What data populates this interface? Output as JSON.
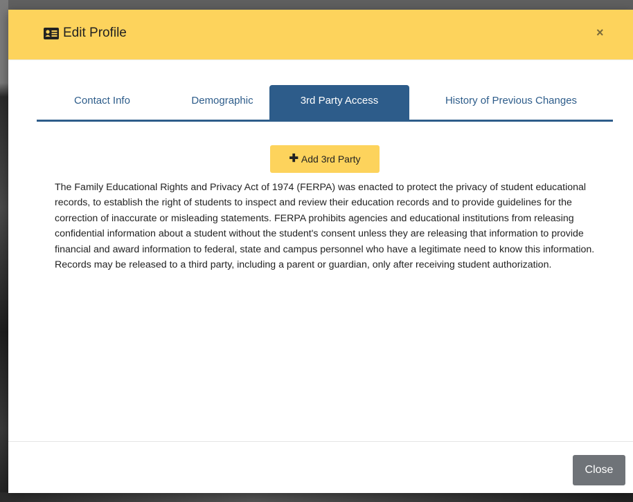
{
  "modal": {
    "title": "Edit Profile",
    "title_icon": "id-card-icon",
    "close_glyph": "×",
    "accent_color": "#fdd35c",
    "tab_color": "#2d5c8a"
  },
  "tabs": [
    {
      "label": "Contact Info",
      "active": false
    },
    {
      "label": "Demographic",
      "active": false
    },
    {
      "label": "3rd Party Access",
      "active": true
    },
    {
      "label": "History of Previous Changes",
      "active": false
    }
  ],
  "content": {
    "add_button_label": "Add 3rd Party",
    "add_button_icon": "plus-icon",
    "ferpa_text": "The Family Educational Rights and Privacy Act of 1974 (FERPA) was enacted to protect the privacy of student educational records, to establish the right of students to inspect and review their education records and to provide guidelines for the correction of inaccurate or misleading statements. FERPA prohibits agencies and educational institutions from releasing confidential information about a student without the student's consent unless they are releasing that information to provide financial and award information to federal, state and campus personnel who have a legitimate need to know this information. Records may be released to a third party, including a parent or guardian, only after receiving student authorization."
  },
  "footer": {
    "close_label": "Close"
  }
}
